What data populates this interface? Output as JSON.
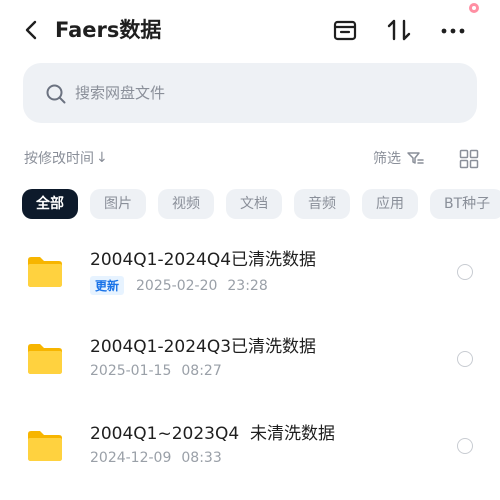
{
  "header": {
    "title": "Faers数据",
    "icons": [
      "back-icon",
      "archive-icon",
      "sort-arrows-icon",
      "more-icon"
    ],
    "notification_color": "#ff8fa3"
  },
  "search": {
    "placeholder": "搜索网盘文件",
    "value": ""
  },
  "toolbar": {
    "sort_label": "按修改时间",
    "sort_arrow": "↓",
    "filter_label": "筛选"
  },
  "tabs": [
    {
      "label": "全部",
      "active": true
    },
    {
      "label": "图片"
    },
    {
      "label": "视频"
    },
    {
      "label": "文档"
    },
    {
      "label": "音频"
    },
    {
      "label": "应用"
    },
    {
      "label": "BT种子"
    }
  ],
  "files": [
    {
      "name": "2004Q1-2024Q4已清洗数据",
      "badge": "更新",
      "date": "2025-02-20",
      "time": "23:28"
    },
    {
      "name": "2004Q1-2024Q3已清洗数据",
      "date": "2025-01-15",
      "time": "08:27"
    },
    {
      "name": "2004Q1~2023Q4  未清洗数据",
      "date": "2024-12-09",
      "time": "08:33"
    }
  ],
  "colors": {
    "accent": "#1a73e8",
    "active_tab": "#0d1a2b",
    "folder": "#ffcc33",
    "muted": "#8a8f99"
  }
}
